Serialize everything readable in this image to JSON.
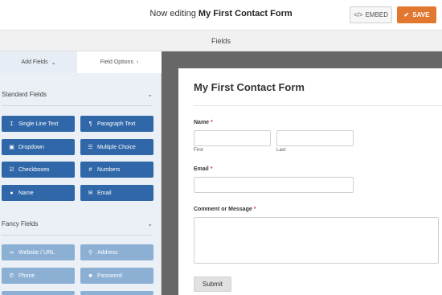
{
  "header": {
    "prefix": "Now editing",
    "form_name": "My First Contact Form",
    "embed_label": "EMBED",
    "embed_icon_text": "</>",
    "save_label": "SAVE",
    "save_icon_text": "✔"
  },
  "fields_bar": {
    "title": "Fields"
  },
  "tabs": {
    "add_fields": "Add Fields",
    "add_fields_icon": "⌄",
    "field_options": "Field Options",
    "field_options_icon": "›"
  },
  "standard": {
    "title": "Standard Fields",
    "chevron": "⌄",
    "items": [
      {
        "label": "Single Line Text",
        "icon": "text-cursor-icon",
        "glyph": "Ɪ"
      },
      {
        "label": "Paragraph Text",
        "icon": "paragraph-icon",
        "glyph": "¶"
      },
      {
        "label": "Dropdown",
        "icon": "dropdown-icon",
        "glyph": "▣"
      },
      {
        "label": "Multiple Choice",
        "icon": "list-icon",
        "glyph": "☰"
      },
      {
        "label": "Checkboxes",
        "icon": "checkbox-icon",
        "glyph": "☑"
      },
      {
        "label": "Numbers",
        "icon": "hash-icon",
        "glyph": "#"
      },
      {
        "label": "Name",
        "icon": "user-icon",
        "glyph": "●"
      },
      {
        "label": "Email",
        "icon": "envelope-icon",
        "glyph": "✉"
      }
    ]
  },
  "fancy": {
    "title": "Fancy Fields",
    "chevron": "⌄",
    "items": [
      {
        "label": "Website / URL",
        "icon": "link-icon",
        "glyph": "∞"
      },
      {
        "label": "Address",
        "icon": "map-pin-icon",
        "glyph": "⚲"
      },
      {
        "label": "Phone",
        "icon": "phone-icon",
        "glyph": "✆"
      },
      {
        "label": "Password",
        "icon": "lock-icon",
        "glyph": "■"
      }
    ]
  },
  "form": {
    "title": "My First Contact Form",
    "name_label": "Name",
    "name_first_sub": "First",
    "name_last_sub": "Last",
    "email_label": "Email",
    "comment_label": "Comment or Message",
    "required_mark": "*",
    "submit_label": "Submit"
  }
}
